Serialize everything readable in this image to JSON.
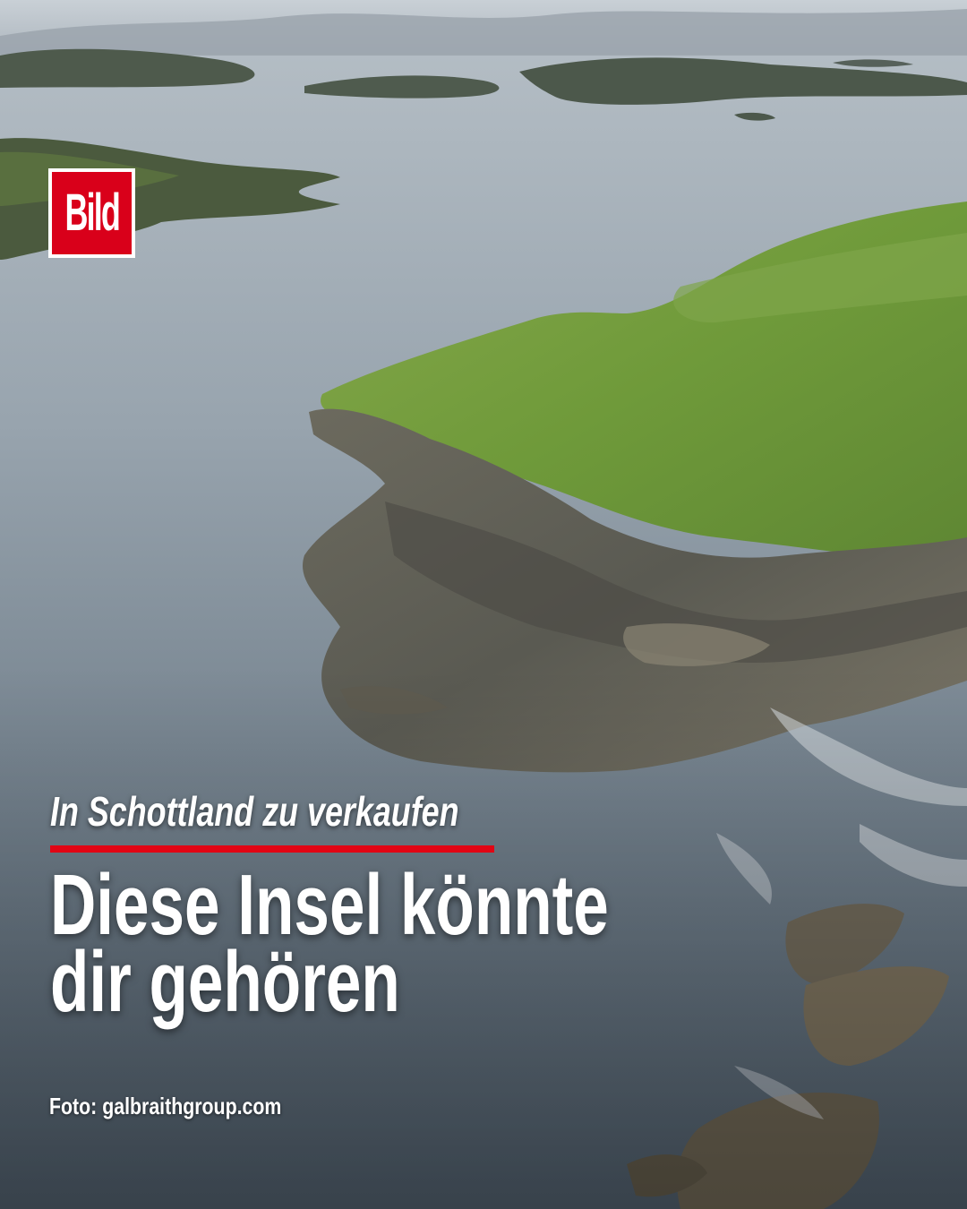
{
  "logo": {
    "text": "Bild"
  },
  "kicker": "In Schottland zu verkaufen",
  "headline": {
    "line1": "Diese Insel könnte",
    "line2": "dir gehören"
  },
  "credit": "Foto: galbraithgroup.com",
  "colors": {
    "accent": "#e10514",
    "logo_bg": "#d9001a",
    "text": "#ffffff"
  }
}
